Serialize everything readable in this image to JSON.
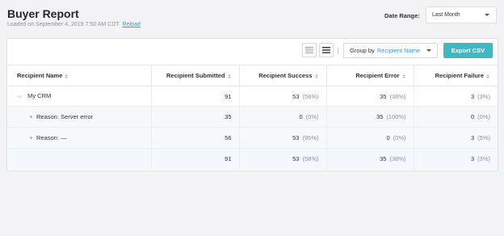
{
  "header": {
    "title": "Buyer Report",
    "loaded_text": "Loaded on September 4, 2019 7:50 AM CDT",
    "reload_label": "Reload",
    "date_range_label": "Date Range:",
    "date_range_value": "Last Month"
  },
  "toolbar": {
    "group_by_label": "Group by",
    "group_by_value": "Recipient Name",
    "export_label": "Export CSV"
  },
  "table": {
    "columns": [
      "Recipient Name",
      "Recipient Submitted",
      "Recipient Success",
      "Recipient Error",
      "Recipient Failure"
    ],
    "rows": [
      {
        "name": "My CRM",
        "submitted": "91",
        "success": "53",
        "success_pct": "(58%)",
        "error": "35",
        "error_pct": "(38%)",
        "failure": "3",
        "failure_pct": "(3%)"
      },
      {
        "name": "Reason: Server error",
        "submitted": "35",
        "success": "0",
        "success_pct": "(0%)",
        "error": "35",
        "error_pct": "(100%)",
        "failure": "0",
        "failure_pct": "(0%)"
      },
      {
        "name": "Reason: —",
        "submitted": "56",
        "success": "53",
        "success_pct": "(95%)",
        "error": "0",
        "error_pct": "(0%)",
        "failure": "3",
        "failure_pct": "(5%)"
      }
    ],
    "total": {
      "name": "",
      "submitted": "91",
      "success": "53",
      "success_pct": "(58%)",
      "error": "35",
      "error_pct": "(38%)",
      "failure": "3",
      "failure_pct": "(3%)"
    }
  },
  "colors": {
    "accent": "#2d9fd9",
    "export_button": "#3fb8c2"
  }
}
